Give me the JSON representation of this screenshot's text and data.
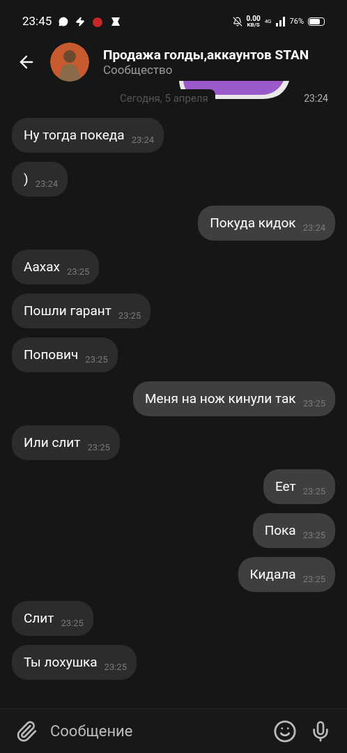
{
  "status_bar": {
    "time": "23:45",
    "speed": "0.00",
    "speed_unit": "KB/S",
    "network": "4G",
    "battery": "76%"
  },
  "header": {
    "title": "Продажа голды,аккаунтов STAN",
    "subtitle": "Сообщество"
  },
  "sticker_time": "23:24",
  "date_chip": "Сегодня, 5 апреля",
  "messages": [
    {
      "text": "Ну тогда покеда",
      "time": "23:24",
      "outgoing": false
    },
    {
      "text": ")",
      "time": "23:24",
      "outgoing": false
    },
    {
      "text": "Покуда кидок",
      "time": "23:24",
      "outgoing": true
    },
    {
      "text": "Аахах",
      "time": "23:25",
      "outgoing": false
    },
    {
      "text": "Пошли гарант",
      "time": "23:25",
      "outgoing": false
    },
    {
      "text": "Попович",
      "time": "23:25",
      "outgoing": false
    },
    {
      "text": "Меня на нож кинули так",
      "time": "23:25",
      "outgoing": true
    },
    {
      "text": "Или слит",
      "time": "23:25",
      "outgoing": false
    },
    {
      "text": "Еет",
      "time": "23:25",
      "outgoing": true
    },
    {
      "text": "Пока",
      "time": "23:25",
      "outgoing": true
    },
    {
      "text": "Кидала",
      "time": "23:25",
      "outgoing": true
    },
    {
      "text": "Слит",
      "time": "23:25",
      "outgoing": false
    },
    {
      "text": "Ты лохушка",
      "time": "23:25",
      "outgoing": false
    }
  ],
  "composer": {
    "placeholder": "Сообщение"
  }
}
